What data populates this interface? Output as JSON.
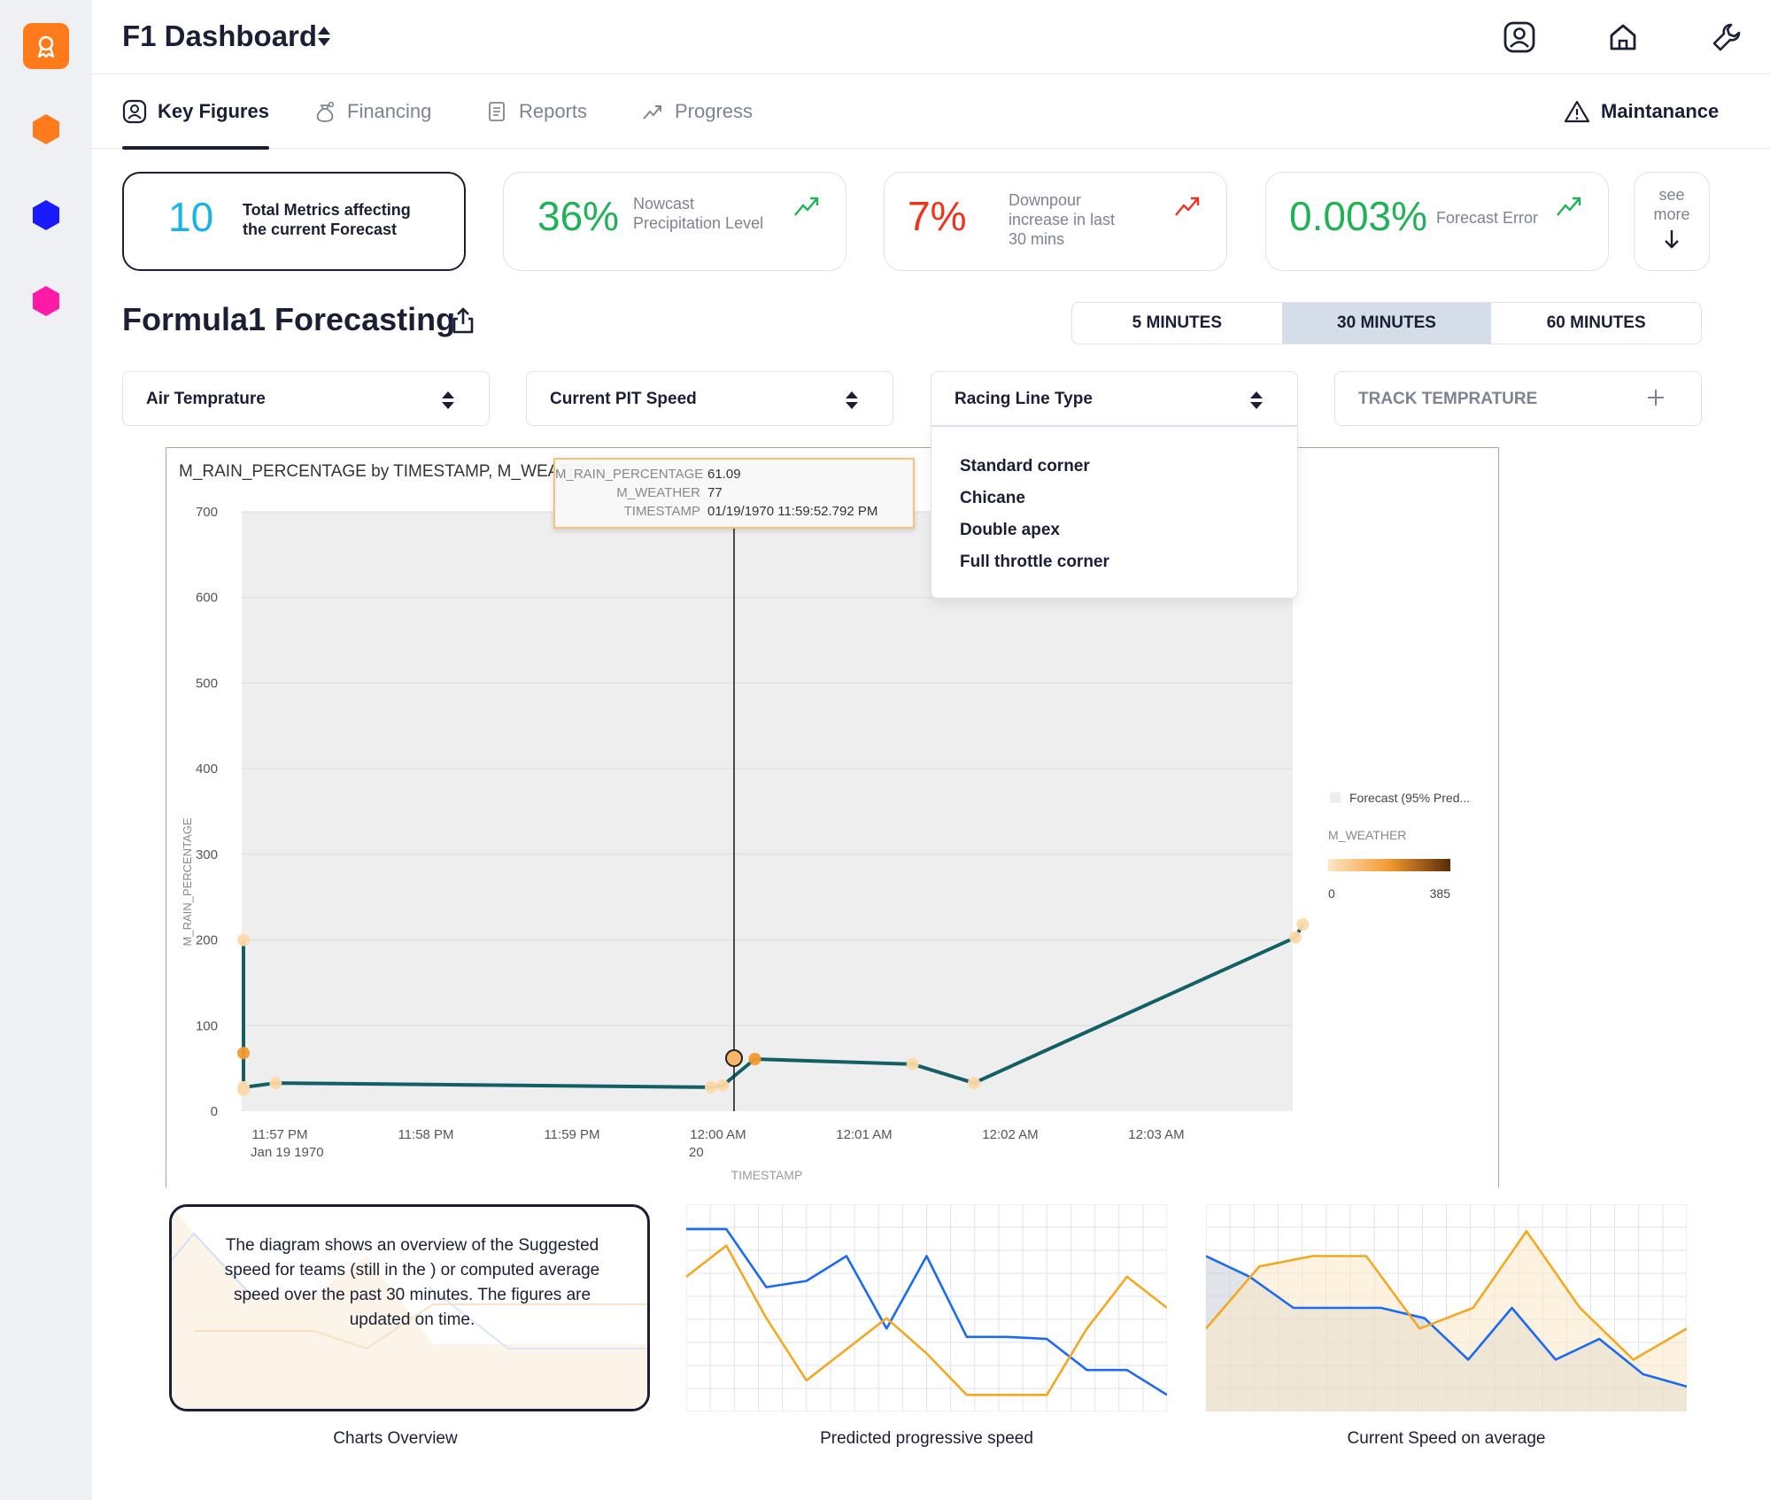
{
  "app": {
    "title": "F1 Dashboard"
  },
  "rail": {
    "icons": [
      "award-icon",
      "orange-hexagon-icon",
      "blue-hexagon-icon",
      "magenta-hexagon-icon"
    ],
    "colors": {
      "logo": "#ff7a1a",
      "hex1": "#ff7a1a",
      "hex2": "#1a1aff",
      "hex3": "#ff1aa8"
    }
  },
  "header": {
    "icons": [
      "user-profile-icon",
      "home-icon",
      "wrench-icon"
    ]
  },
  "tabs": [
    {
      "label": "Key Figures",
      "icon": "user-square-icon",
      "active": true
    },
    {
      "label": "Financing",
      "icon": "money-bag-icon",
      "active": false
    },
    {
      "label": "Reports",
      "icon": "document-icon",
      "active": false
    },
    {
      "label": "Progress",
      "icon": "trend-up-icon",
      "active": false
    }
  ],
  "maintenance": {
    "label": "Maintanance",
    "icon": "warning-triangle-icon"
  },
  "kpis": [
    {
      "value": "10",
      "label_line1": "Total Metrics affecting",
      "label_line2": "the  current Forecast",
      "color": "#17b5e6"
    },
    {
      "value": "36%",
      "label_line1": "Nowcast",
      "label_line2": "Precipitation Level",
      "color": "#1fb257",
      "trend_color": "#1fb257"
    },
    {
      "value": "7%",
      "label_line1": "Downpour",
      "label_line2": "increase in last",
      "label_line3": "30 mins",
      "color": "#f0311c",
      "trend_color": "#f0311c"
    },
    {
      "value": "0.003%",
      "label_line1": "Forecast Error",
      "color": "#1fb257",
      "trend_color": "#1fb257"
    }
  ],
  "see_more": {
    "line1": "see",
    "line2": "more"
  },
  "section": {
    "title": "Formula1 Forecasting"
  },
  "time_ranges": [
    {
      "label": "5 MINUTES",
      "active": false
    },
    {
      "label": "30 MINUTES",
      "active": true
    },
    {
      "label": "60 MINUTES",
      "active": false
    }
  ],
  "filters": {
    "air": "Air Temprature",
    "pit": "Current PIT Speed",
    "racing": "Racing Line Type",
    "track": "TRACK TEMPRATURE"
  },
  "dropdown_options": [
    "Standard corner",
    "Chicane",
    "Double apex",
    "Full throttle corner"
  ],
  "tooltip": {
    "rows": [
      {
        "key": "M_RAIN_PERCENTAGE",
        "value": "61.09"
      },
      {
        "key": "M_WEATHER",
        "value": "77"
      },
      {
        "key": "TIMESTAMP",
        "value": "01/19/1970 11:59:52.792 PM"
      }
    ]
  },
  "chart_data": {
    "type": "line",
    "title": "M_RAIN_PERCENTAGE by TIMESTAMP, M_WEATHER",
    "xlabel": "TIMESTAMP",
    "ylabel": "M_RAIN_PERCENTAGE",
    "ylim": [
      0,
      700
    ],
    "yticks": [
      0,
      100,
      200,
      300,
      400,
      500,
      600,
      700
    ],
    "xticks": [
      "11:57 PM",
      "11:58 PM",
      "11:59 PM",
      "12:00 AM",
      "12:01 AM",
      "12:02 AM",
      "12:03 AM"
    ],
    "xtick_sublabels": [
      "Jan 19 1970",
      "",
      "",
      "20",
      "",
      "",
      ""
    ],
    "series": [
      {
        "name": "M_RAIN_PERCENTAGE",
        "x_minutes": [
          0.0,
          0.0,
          0.0,
          0.0,
          0.22,
          3.2,
          3.28,
          3.5,
          4.58,
          5.0,
          7.2,
          7.25
        ],
        "values": [
          200,
          68,
          25,
          28,
          33,
          28,
          30,
          61,
          55,
          33,
          203,
          218
        ],
        "color": "#135f66"
      }
    ],
    "legend": {
      "forecast_label": "Forecast (95% Pred...",
      "color_title": "M_WEATHER",
      "color_min": "0",
      "color_max": "385"
    },
    "grid": true,
    "legend_position": "right"
  },
  "mini_charts": [
    {
      "caption": "Charts Overview",
      "description": "The diagram shows an overview of the Suggested speed for teams (still in the ) or computed average speed over the past 30 minutes. The figures are updated on time."
    },
    {
      "caption": "Predicted progressive speed",
      "series": [
        {
          "color": "#1a6bf0",
          "values": [
            88,
            88,
            60,
            63,
            75,
            40,
            75,
            36,
            36,
            35,
            20,
            20,
            8
          ]
        },
        {
          "color": "#f4a820",
          "values": [
            65,
            80,
            45,
            15,
            30,
            45,
            28,
            8,
            8,
            8,
            40,
            65,
            50
          ]
        }
      ]
    },
    {
      "caption": "Current Speed on average",
      "series": [
        {
          "color": "#1a6bf0",
          "values": [
            75,
            65,
            50,
            50,
            50,
            45,
            25,
            50,
            25,
            35,
            18,
            12
          ]
        },
        {
          "color": "#f4a820",
          "values": [
            40,
            70,
            75,
            75,
            40,
            50,
            87,
            50,
            25,
            40
          ]
        }
      ]
    }
  ]
}
